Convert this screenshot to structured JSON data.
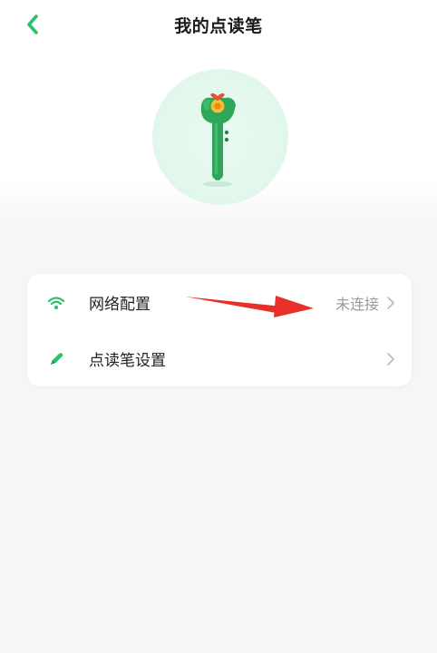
{
  "header": {
    "title": "我的点读笔",
    "back_icon": "chevron-left-icon"
  },
  "hero": {
    "image": "green-reading-pen-illustration"
  },
  "settings": {
    "items": [
      {
        "label": "网络配置",
        "value": "未连接",
        "icon": "wifi-icon"
      },
      {
        "label": "点读笔设置",
        "value": "",
        "icon": "pen-icon"
      }
    ]
  },
  "colors": {
    "accent": "#2cc06d",
    "annotation_arrow": "#e8302a",
    "background": "#f6f6f8",
    "card": "#ffffff",
    "muted_text": "#9a9a9a"
  }
}
